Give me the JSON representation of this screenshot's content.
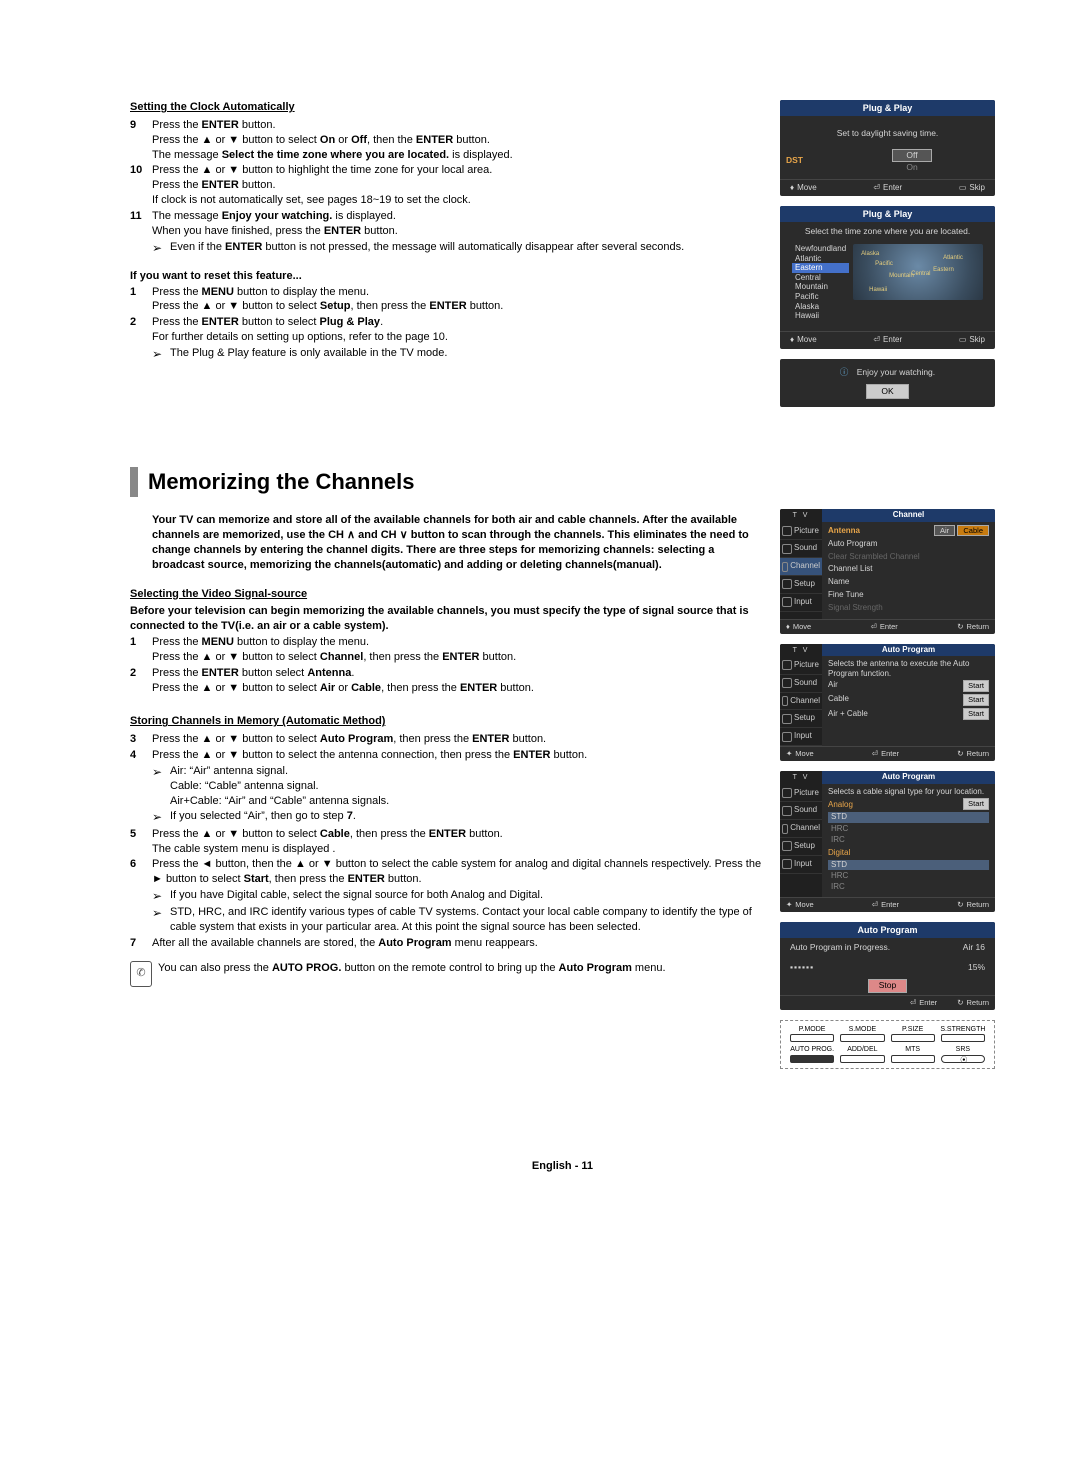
{
  "section1": {
    "heading": "Setting the Clock Automatically",
    "step9": {
      "num": "9",
      "line1_a": "Press the ",
      "line1_b": "ENTER",
      "line1_c": " button.",
      "line2_a": "Press the ▲ or ▼ button to select ",
      "line2_b": "On",
      "line2_c": " or ",
      "line2_d": "Off",
      "line2_e": ", then the ",
      "line2_f": "ENTER",
      "line2_g": " button.",
      "line3_a": "The message ",
      "line3_b": "Select the time zone where you are located.",
      "line3_c": " is displayed."
    },
    "step10": {
      "num": "10",
      "line1": "Press the ▲ or ▼ button to highlight the time zone for your local area.",
      "line2_a": "Press the ",
      "line2_b": "ENTER",
      "line2_c": " button.",
      "line3": "If clock is not automatically set, see pages 18~19 to set the clock."
    },
    "step11": {
      "num": "11",
      "line1_a": "The message ",
      "line1_b": "Enjoy your watching.",
      "line1_c": " is displayed.",
      "line2_a": "When you have finished, press the ",
      "line2_b": "ENTER",
      "line2_c": " button.",
      "note_a": "Even if the ",
      "note_b": "ENTER",
      "note_c": " button is not pressed, the message will automatically disappear after several seconds."
    }
  },
  "reset": {
    "heading": "If you want to reset this feature...",
    "step1": {
      "num": "1",
      "line1_a": "Press the ",
      "line1_b": "MENU",
      "line1_c": " button to display the menu.",
      "line2_a": "Press the ▲ or ▼ button to select ",
      "line2_b": "Setup",
      "line2_c": ", then press the ",
      "line2_d": "ENTER",
      "line2_e": " button."
    },
    "step2": {
      "num": "2",
      "line1_a": "Press the ",
      "line1_b": "ENTER",
      "line1_c": " button to select ",
      "line1_d": "Plug & Play",
      "line1_e": ".",
      "line2": "For further details on setting up options, refer to the page 10.",
      "note": "The Plug & Play feature is only available in the TV mode."
    }
  },
  "section2": {
    "big_heading": "Memorizing the Channels",
    "intro": "Your TV can memorize and store all of the available channels for both air and cable channels. After the available channels are memorized, use the CH ∧ and CH ∨ button to scan through the channels. This eliminates the need to change channels by entering the channel digits. There are three steps for memorizing channels: selecting a broadcast source, memorizing the channels(automatic) and adding or deleting channels(manual).",
    "sub1_heading": "Selecting the Video Signal-source",
    "sub1_intro": "Before your television can begin memorizing the available channels, you must specify the type of signal source that is connected to the TV(i.e. an air or a cable system).",
    "s1step1": {
      "num": "1",
      "line1_a": "Press the ",
      "line1_b": "MENU",
      "line1_c": " button to display the menu.",
      "line2_a": "Press the ▲ or ▼ button to select ",
      "line2_b": "Channel",
      "line2_c": ", then press the ",
      "line2_d": "ENTER",
      "line2_e": " button."
    },
    "s1step2": {
      "num": "2",
      "line1_a": "Press the ",
      "line1_b": "ENTER",
      "line1_c": " button select ",
      "line1_d": "Antenna",
      "line1_e": ".",
      "line2_a": "Press the ▲ or ▼ button to select ",
      "line2_b": "Air",
      "line2_c": " or ",
      "line2_d": "Cable",
      "line2_e": ", then press the ",
      "line2_f": "ENTER",
      "line2_g": " button."
    },
    "sub2_heading": "Storing Channels in Memory (Automatic Method)",
    "s2step3": {
      "num": "3",
      "line_a": "Press the ▲ or ▼ button to select ",
      "line_b": "Auto Program",
      "line_c": ", then press the ",
      "line_d": "ENTER",
      "line_e": " button."
    },
    "s2step4": {
      "num": "4",
      "line_a": "Press the ▲ or ▼ button to select the antenna connection, then press the ",
      "line_b": "ENTER",
      "line_c": " button.",
      "note1": "Air: “Air” antenna signal.",
      "note2": "Cable: “Cable” antenna signal.",
      "note3": "Air+Cable: “Air” and “Cable” antenna signals.",
      "note4_a": "If you selected “Air”, then go to step ",
      "note4_b": "7",
      "note4_c": "."
    },
    "s2step5": {
      "num": "5",
      "line1_a": "Press the ▲ or ▼ button to select ",
      "line1_b": "Cable",
      "line1_c": ", then press the ",
      "line1_d": "ENTER",
      "line1_e": " button.",
      "line2": "The cable system menu is displayed ."
    },
    "s2step6": {
      "num": "6",
      "line1_a": "Press the ◄ button, then the  ▲ or ▼ button to select the cable system for analog and digital channels respectively. Press the ► button to select ",
      "line1_b": "Start",
      "line1_c": ", then press the ",
      "line1_d": "ENTER",
      "line1_e": " button.",
      "note1": "If you have Digital cable, select the signal source for both Analog and Digital.",
      "note2": "STD, HRC, and IRC identify various types of cable TV systems. Contact your local cable company to identify the type of cable system that exists in your particular area. At this point the signal source has been selected."
    },
    "s2step7": {
      "num": "7",
      "line_a": "After all the available channels are stored, the ",
      "line_b": "Auto Program",
      "line_c": " menu reappears."
    },
    "footnote_a": "You can also press the ",
    "footnote_b": "AUTO PROG.",
    "footnote_c": " button on the remote control to bring up the ",
    "footnote_d": "Auto Program",
    "footnote_e": " menu."
  },
  "osd": {
    "pp": {
      "title1": "Plug & Play",
      "set_dst": "Set to daylight saving time.",
      "dst": "DST",
      "off": "Off",
      "on": "On",
      "move": "Move",
      "enter": "Enter",
      "skip": "Skip",
      "return": "Return",
      "tz_msg": "Select the time zone where you are located.",
      "tz": {
        "nf": "Newfoundland",
        "at": "Atlantic",
        "ea": "Eastern",
        "ce": "Central",
        "mo": "Mountain",
        "pa": "Pacific",
        "al": "Alaska",
        "ha": "Hawaii"
      },
      "map_labels": {
        "a": "Alaska",
        "p": "Pacific",
        "m": "Mountain",
        "c": "Central",
        "e": "Eastern",
        "at": "Atlantic",
        "h": "Hawaii"
      },
      "enjoy": "Enjoy your watching.",
      "ok": "OK"
    },
    "tv_label": "T V",
    "tabs": {
      "picture": "Picture",
      "sound": "Sound",
      "channel": "Channel",
      "setup": "Setup",
      "input": "Input"
    },
    "channel_menu": {
      "title": "Channel",
      "antenna": "Antenna",
      "air": "Air",
      "cable": "Cable",
      "auto_program": "Auto Program",
      "clear_scrambled": "Clear Scrambled Channel",
      "channel_list": "Channel List",
      "name": "Name",
      "fine_tune": "Fine Tune",
      "signal_strength": "Signal Strength"
    },
    "auto1": {
      "title": "Auto Program",
      "msg": "Selects the antenna to execute the Auto Program function.",
      "air": "Air",
      "cable": "Cable",
      "air_cable": "Air + Cable",
      "start": "Start"
    },
    "auto2": {
      "title": "Auto Program",
      "msg": "Selects a cable signal type for your location.",
      "analog": "Analog",
      "digital": "Digital",
      "std": "STD",
      "hrc": "HRC",
      "irc": "IRC",
      "start": "Start"
    },
    "auto3": {
      "title": "Auto Program",
      "msg": "Auto Program in Progress.",
      "ch": "Air 16",
      "pct": "15%",
      "stop": "Stop",
      "bars": "▪▪▪▪▪▪"
    },
    "remote": {
      "r1": [
        "P.MODE",
        "S.MODE",
        "P.SIZE",
        "S.STRENGTH"
      ],
      "r2": [
        "AUTO PROG.",
        "ADD/DEL",
        "MTS",
        "SRS"
      ]
    }
  },
  "arrow": "➢",
  "footer": "English - 11"
}
